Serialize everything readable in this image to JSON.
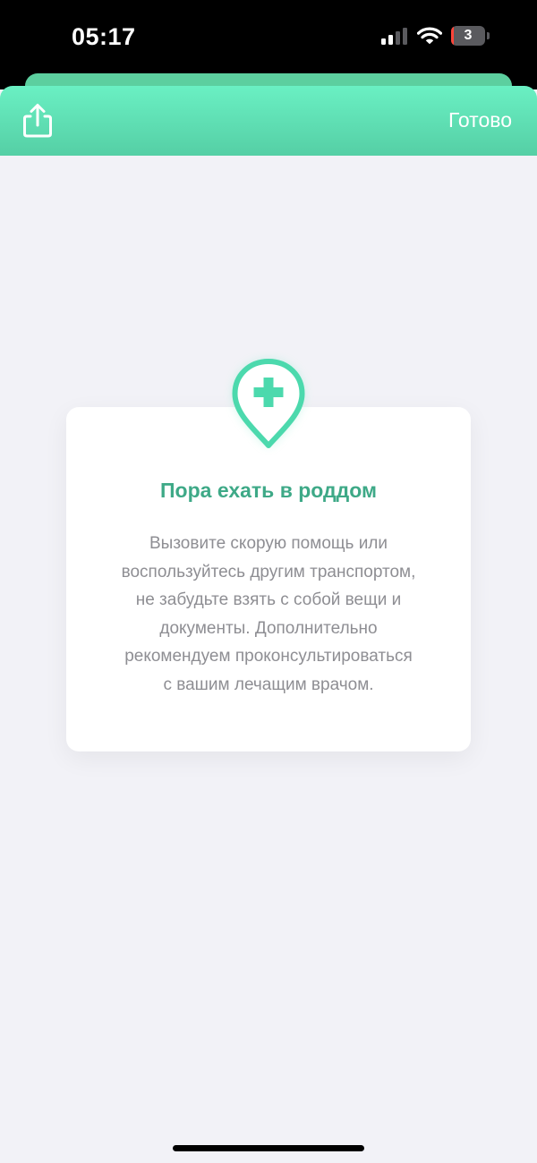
{
  "status_bar": {
    "time": "05:17",
    "battery_level": "3",
    "battery_fraction": 0.03,
    "signal_bars_active": 2,
    "signal_bars_total": 4,
    "signal_icon": "cellular-signal-icon",
    "wifi_icon": "wifi-icon"
  },
  "header": {
    "share_icon": "share-icon",
    "done_label": "Готово"
  },
  "card": {
    "icon": "hospital-pin-icon",
    "title": "Пора ехать в роддом",
    "lines": [
      "Вызовите скорую помощь или",
      "воспользуйтесь другим транспортом,",
      "не забудьте взять с собой вещи и",
      "документы. Дополнительно",
      "рекомендуем проконсультироваться",
      "с вашим лечащим врачом."
    ]
  },
  "colors": {
    "header_top": "#6af0c3",
    "header_bottom": "#55cfa5",
    "accent": "#3ea987",
    "pin": "#4cd9ad",
    "body_text": "#8e8e93",
    "background": "#f2f2f7"
  }
}
